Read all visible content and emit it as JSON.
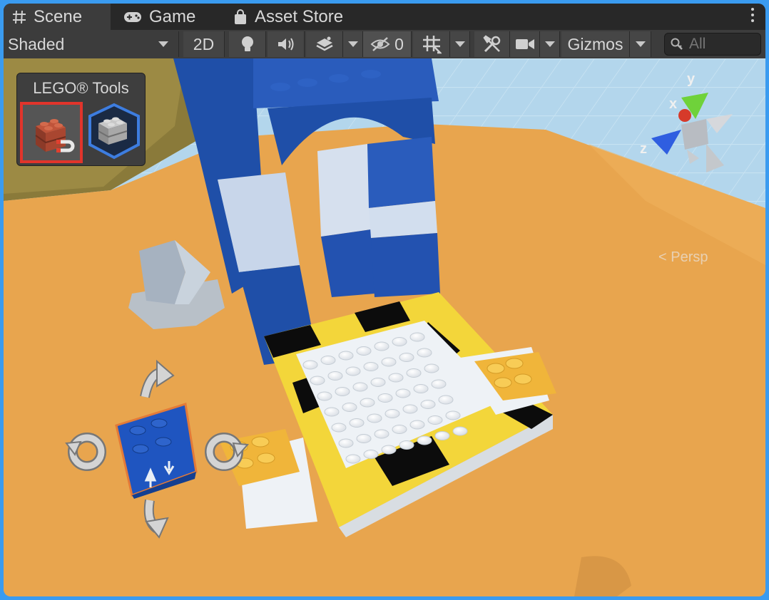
{
  "tabs": [
    {
      "label": "Scene",
      "icon": "hash-icon",
      "active": true
    },
    {
      "label": "Game",
      "icon": "gamepad-icon",
      "active": false
    },
    {
      "label": "Asset Store",
      "icon": "shopping-bag-icon",
      "active": false
    }
  ],
  "toolbar": {
    "draw_mode": "Shaded",
    "mode_2d": "2D",
    "hidden_count": "0",
    "gizmos": "Gizmos",
    "search_placeholder": "All"
  },
  "lego_tools": {
    "title": "LEGO® Tools",
    "tools": [
      {
        "name": "brick-magnet-tool",
        "selected": true
      },
      {
        "name": "brick-group-tool",
        "selected": false
      }
    ]
  },
  "gizmo": {
    "x_label": "x",
    "y_label": "y",
    "z_label": "z",
    "projection": "< Persp"
  },
  "colors": {
    "accent_red": "#e1342b",
    "lego_blue": "#1f4fa8",
    "lego_yellow": "#f0c230",
    "sand": "#e9a64e",
    "sky": "#a9cfe6"
  }
}
